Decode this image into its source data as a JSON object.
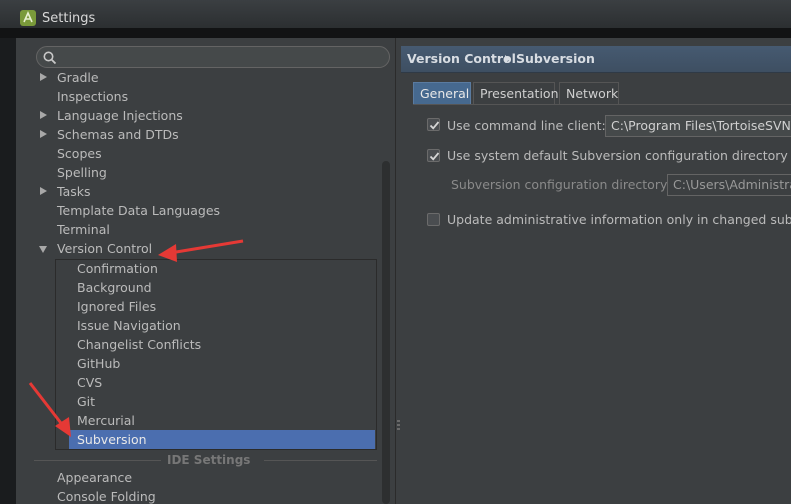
{
  "window": {
    "title": "Settings",
    "icon": "android-studio-icon"
  },
  "search": {
    "placeholder": "",
    "icon": "search-icon"
  },
  "tree": {
    "items": [
      {
        "label": "Gradle",
        "expand": "collapsed"
      },
      {
        "label": "Inspections",
        "expand": "none"
      },
      {
        "label": "Language Injections",
        "expand": "collapsed"
      },
      {
        "label": "Schemas and DTDs",
        "expand": "collapsed"
      },
      {
        "label": "Scopes",
        "expand": "none"
      },
      {
        "label": "Spelling",
        "expand": "none"
      },
      {
        "label": "Tasks",
        "expand": "collapsed"
      },
      {
        "label": "Template Data Languages",
        "expand": "none"
      },
      {
        "label": "Terminal",
        "expand": "none"
      },
      {
        "label": "Version Control",
        "expand": "expanded"
      }
    ],
    "children": [
      "Confirmation",
      "Background",
      "Ignored Files",
      "Issue Navigation",
      "Changelist Conflicts",
      "GitHub",
      "CVS",
      "Git",
      "Mercurial"
    ],
    "selected": "Subversion",
    "section_header": "IDE Settings",
    "after": [
      "Appearance",
      "Console Folding"
    ]
  },
  "header": {
    "parent": "Version Control",
    "current": "Subversion"
  },
  "tabs": [
    {
      "label": "General",
      "active": true
    },
    {
      "label": "Presentation",
      "active": false
    },
    {
      "label": "Network",
      "active": false
    }
  ],
  "general": {
    "cmd_client": {
      "label": "Use command line client:",
      "checked": true,
      "value": "C:\\Program Files\\TortoiseSVN\\"
    },
    "system_default": {
      "label": "Use system default Subversion configuration directory",
      "checked": true
    },
    "config_dir": {
      "label": "Subversion configuration directory:",
      "value": "C:\\Users\\Administrato"
    },
    "update_admin": {
      "label": "Update administrative information only in changed subtrees",
      "checked": false
    }
  },
  "colors": {
    "selection": "#4b6eaf",
    "header": "#435669",
    "arrow": "#e53935",
    "panel": "#3c3f41"
  }
}
